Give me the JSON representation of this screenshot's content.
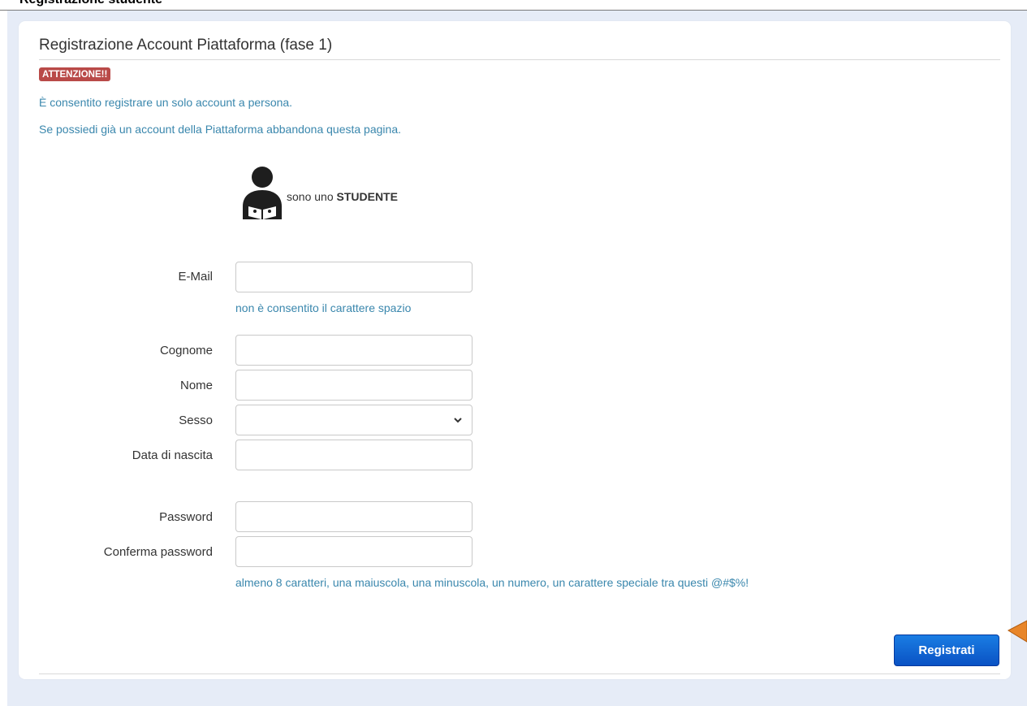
{
  "top_strip_text": "Registrazione studente",
  "title": "Registrazione Account Piattaforma (fase 1)",
  "badge": "ATTENZIONE!!",
  "notices": [
    "È consentito registrare un solo account a persona.",
    "Se possiedi già un account della Piattaforma abbandona questa pagina."
  ],
  "role": {
    "prefix": "sono uno",
    "name": "STUDENTE",
    "icon": "student-reading-icon"
  },
  "form": {
    "email_label": "E-Mail",
    "email_value": "",
    "email_help": "non è consentito il carattere spazio",
    "cognome_label": "Cognome",
    "cognome_value": "",
    "nome_label": "Nome",
    "nome_value": "",
    "sesso_label": "Sesso",
    "sesso_value": "",
    "nascita_label": "Data di nascita",
    "nascita_value": "",
    "password_label": "Password",
    "password_value": "",
    "conferma_label": "Conferma password",
    "conferma_value": "",
    "password_help": "almeno 8 caratteri, una maiuscola, una minuscola, un numero, un carattere speciale tra questi @#$%!"
  },
  "submit_label": "Registrati",
  "colors": {
    "accent": "#3a87ad",
    "badge": "#b94a48",
    "button": "#0a52c4",
    "annotation_arrow": "#e8862a"
  }
}
